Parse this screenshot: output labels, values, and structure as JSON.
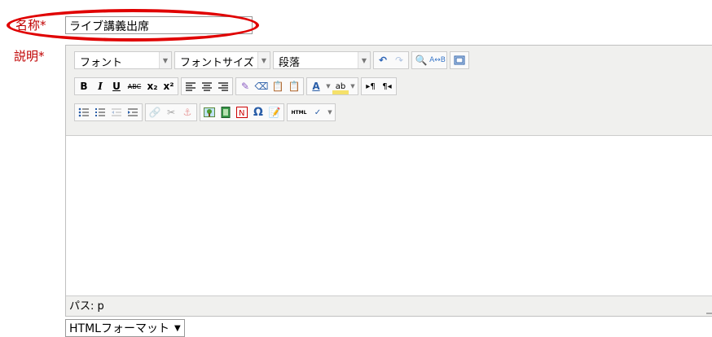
{
  "form": {
    "name_label": "名称",
    "required_mark": "*",
    "name_value": "ライブ講義出席",
    "description_label": "説明",
    "format_value": "HTMLフォーマット"
  },
  "toolbar": {
    "font_select": "フォント",
    "font_size_select": "フォントサイズ",
    "paragraph_select": "段落",
    "row1_icons": [
      "undo-icon",
      "redo-icon",
      "find-icon",
      "replace-icon",
      "fullscreen-icon"
    ],
    "row2_icons": [
      "bold-icon",
      "italic-icon",
      "underline-icon",
      "strikethrough-icon",
      "subscript-icon",
      "superscript-icon",
      "align-left-icon",
      "align-center-icon",
      "align-right-icon",
      "cleanup-icon",
      "remove-format-icon",
      "paste-text-icon",
      "paste-word-icon",
      "text-color-icon",
      "highlight-color-icon",
      "ltr-icon",
      "rtl-icon"
    ],
    "row3_icons": [
      "bullet-list-icon",
      "numbered-list-icon",
      "outdent-icon",
      "indent-icon",
      "link-icon",
      "unlink-icon",
      "anchor-icon",
      "image-icon",
      "media-icon",
      "nolink-icon",
      "special-char-icon",
      "edit-icon",
      "html-source-icon",
      "spellcheck-icon"
    ],
    "glyphs": {
      "bold": "B",
      "italic": "I",
      "underline": "U",
      "strike": "ABC",
      "sub": "x₂",
      "sup": "x²",
      "omega": "Ω",
      "html": "HTML",
      "text_color": "A"
    }
  },
  "editor": {
    "path_text": "パス: p"
  },
  "colors": {
    "label_red": "#c00000",
    "highlight_oval": "#e00000"
  }
}
